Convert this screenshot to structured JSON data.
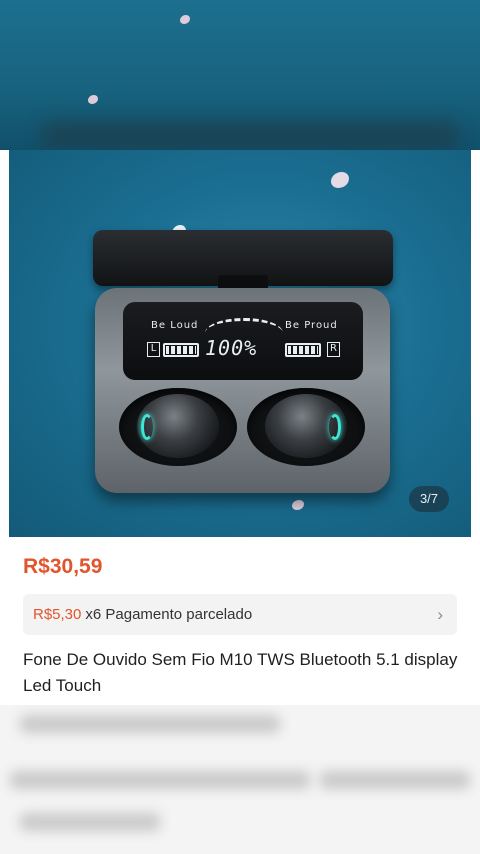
{
  "product": {
    "image_counter": "3/7",
    "price": "R$30,59",
    "installment_price": "R$5,30",
    "installment_text": "x6 Pagamento parcelado",
    "title": "Fone De Ouvido Sem Fio M10 TWS Bluetooth 5.1 display Led Touch"
  },
  "case_display": {
    "left_label": "Be  Loud",
    "right_label": "Be  Proud",
    "left_letter": "L",
    "right_letter": "R",
    "percent": "100%"
  },
  "icons": {
    "chevron": "chevron-right-icon"
  },
  "colors": {
    "accent": "#e2542b",
    "led": "#3fe6d5"
  }
}
